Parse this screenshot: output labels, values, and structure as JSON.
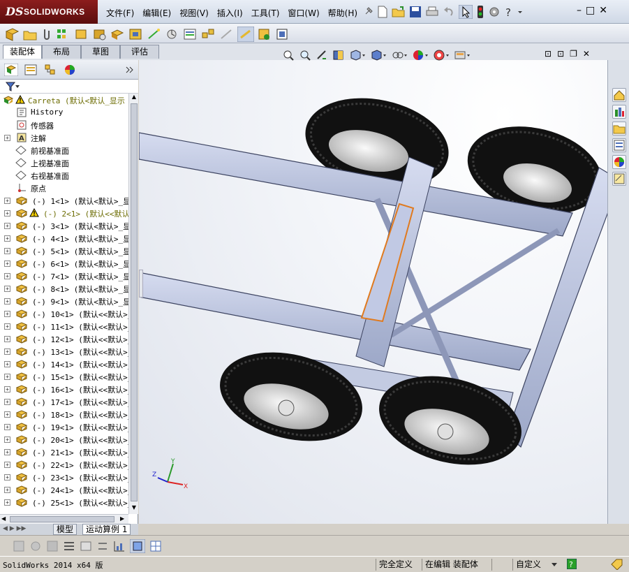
{
  "app": {
    "logo_ds": "DS",
    "logo_text": "SOLIDWORKS"
  },
  "menu": [
    "文件(F)",
    "编辑(E)",
    "视图(V)",
    "插入(I)",
    "工具(T)",
    "窗口(W)",
    "帮助(H)"
  ],
  "tabs": [
    "装配体",
    "布局",
    "草图",
    "评估"
  ],
  "tree": {
    "root": "Carreta  (默认<默认_显示",
    "items": [
      {
        "label": "History",
        "icon": "history-icon"
      },
      {
        "label": "传感器",
        "icon": "sensor-icon"
      },
      {
        "label": "注解",
        "icon": "annotation-icon"
      },
      {
        "label": "前视基准面",
        "icon": "plane-icon"
      },
      {
        "label": "上视基准面",
        "icon": "plane-icon"
      },
      {
        "label": "右视基准面",
        "icon": "plane-icon"
      },
      {
        "label": "原点",
        "icon": "origin-icon"
      }
    ],
    "parts": [
      "(-) 1<1> (默认<默认>_显",
      "(-) 2<1> (默认<<默认",
      "(-) 3<1> (默认<默认>_显",
      "(-) 4<1> (默认<默认>_显",
      "(-) 5<1> (默认<默认>_显",
      "(-) 6<1> (默认<默认>_显",
      "(-) 7<1> (默认<默认>_显",
      "(-) 8<1> (默认<默认>_显",
      "(-) 9<1> (默认<默认>_显",
      "(-) 10<1> (默认<<默认>_",
      "(-) 11<1> (默认<<默认>_",
      "(-) 12<1> (默认<<默认>_",
      "(-) 13<1> (默认<<默认>_",
      "(-) 14<1> (默认<<默认>_",
      "(-) 15<1> (默认<<默认>_",
      "(-) 16<1> (默认<<默认>_",
      "(-) 17<1> (默认<<默认>_",
      "(-) 18<1> (默认<<默认>_",
      "(-) 19<1> (默认<<默认>_",
      "(-) 20<1> (默认<<默认>_",
      "(-) 21<1> (默认<<默认>_",
      "(-) 22<1> (默认<<默认>_",
      "(-) 23<1> (默认<<默认>_",
      "(-) 24<1> (默认<<默认>_",
      "(-) 25<1> (默认<<默认>_"
    ]
  },
  "bottom_tabs": [
    "模型",
    "运动算例 1"
  ],
  "axes": {
    "x": "X",
    "y": "Y",
    "z": "Z"
  },
  "status": {
    "app": "SolidWorks 2014 x64 版",
    "constraint": "完全定义",
    "mode": "在编辑 装配体",
    "units": "自定义"
  },
  "colors": {
    "frame": "#b7c0dc",
    "tire": "#1b1b1b",
    "highlight": "#e07a1f"
  }
}
